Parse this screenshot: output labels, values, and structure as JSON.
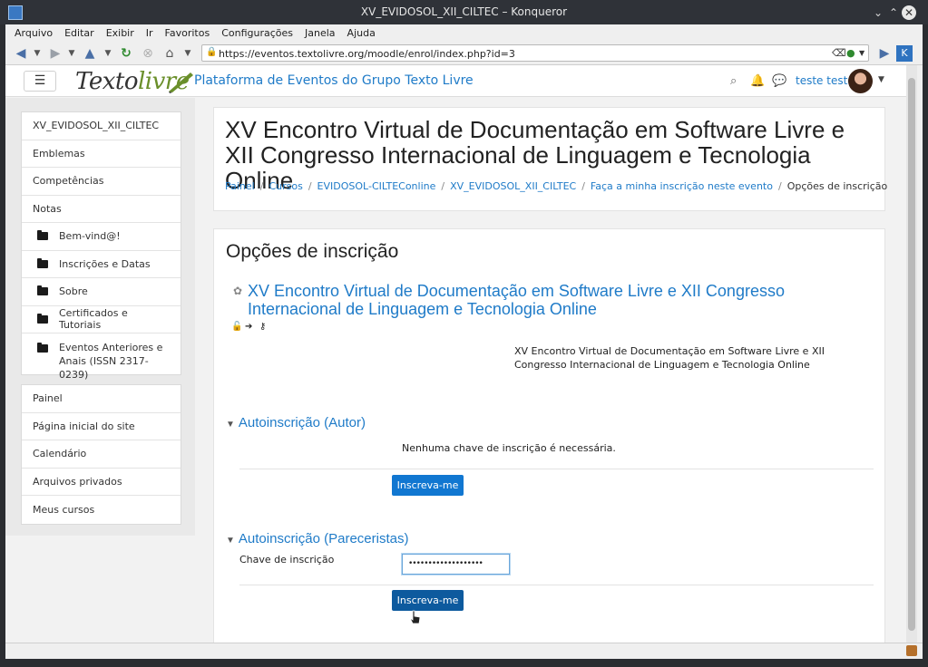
{
  "window": {
    "title": "XV_EVIDOSOL_XII_CILTEC – Konqueror"
  },
  "menu": [
    "Arquivo",
    "Editar",
    "Exibir",
    "Ir",
    "Favoritos",
    "Configurações",
    "Janela",
    "Ajuda"
  ],
  "toolbar": {
    "url": "https://eventos.textolivre.org/moodle/enrol/index.php?id=3"
  },
  "navbar": {
    "logo_part1": "Texto",
    "logo_part2": "livre",
    "site_name": "Plataforma de Eventos do Grupo Texto Livre",
    "username": "teste teste"
  },
  "sidebar": {
    "course_items": [
      {
        "label": "XV_EVIDOSOL_XII_CILTEC"
      },
      {
        "label": "Emblemas"
      },
      {
        "label": "Competências"
      },
      {
        "label": "Notas"
      },
      {
        "label": "Bem-vind@!"
      },
      {
        "label": "Inscrições e Datas"
      },
      {
        "label": "Sobre"
      },
      {
        "label": "Certificados e Tutoriais"
      },
      {
        "label": "Eventos Anteriores e Anais (ISSN 2317-0239)"
      }
    ],
    "site_items": [
      {
        "label": "Painel"
      },
      {
        "label": "Página inicial do site"
      },
      {
        "label": "Calendário"
      },
      {
        "label": "Arquivos privados"
      },
      {
        "label": "Meus cursos"
      }
    ]
  },
  "header": {
    "title": "XV Encontro Virtual de Documentação em Software Livre e XII Congresso Internacional de Linguagem e Tecnologia Online",
    "breadcrumbs": [
      "Painel",
      "Cursos",
      "EVIDOSOL-CILTEConline",
      "XV_EVIDOSOL_XII_CILTEC",
      "Faça a minha inscrição neste evento"
    ],
    "breadcrumb_current": "Opções de inscrição"
  },
  "main": {
    "heading": "Opções de inscrição",
    "course_name": "XV Encontro Virtual de Documentação em Software Livre e XII Congresso Internacional de Linguagem e Tecnologia Online",
    "course_summary": "XV Encontro Virtual de Documentação em Software Livre e XII Congresso Internacional de Linguagem e Tecnologia Online",
    "section1": {
      "title": "Autoinscrição (Autor)",
      "note": "Nenhuma chave de inscrição é necessária.",
      "button": "Inscreva-me"
    },
    "section2": {
      "title": "Autoinscrição (Pareceristas)",
      "key_label": "Chave de inscrição",
      "key_value": "•••••••••••••••••••",
      "button": "Inscreva-me"
    }
  },
  "colors": {
    "link": "#1f7bc8",
    "button": "#1177d1",
    "button_active": "#0d5a9e"
  }
}
